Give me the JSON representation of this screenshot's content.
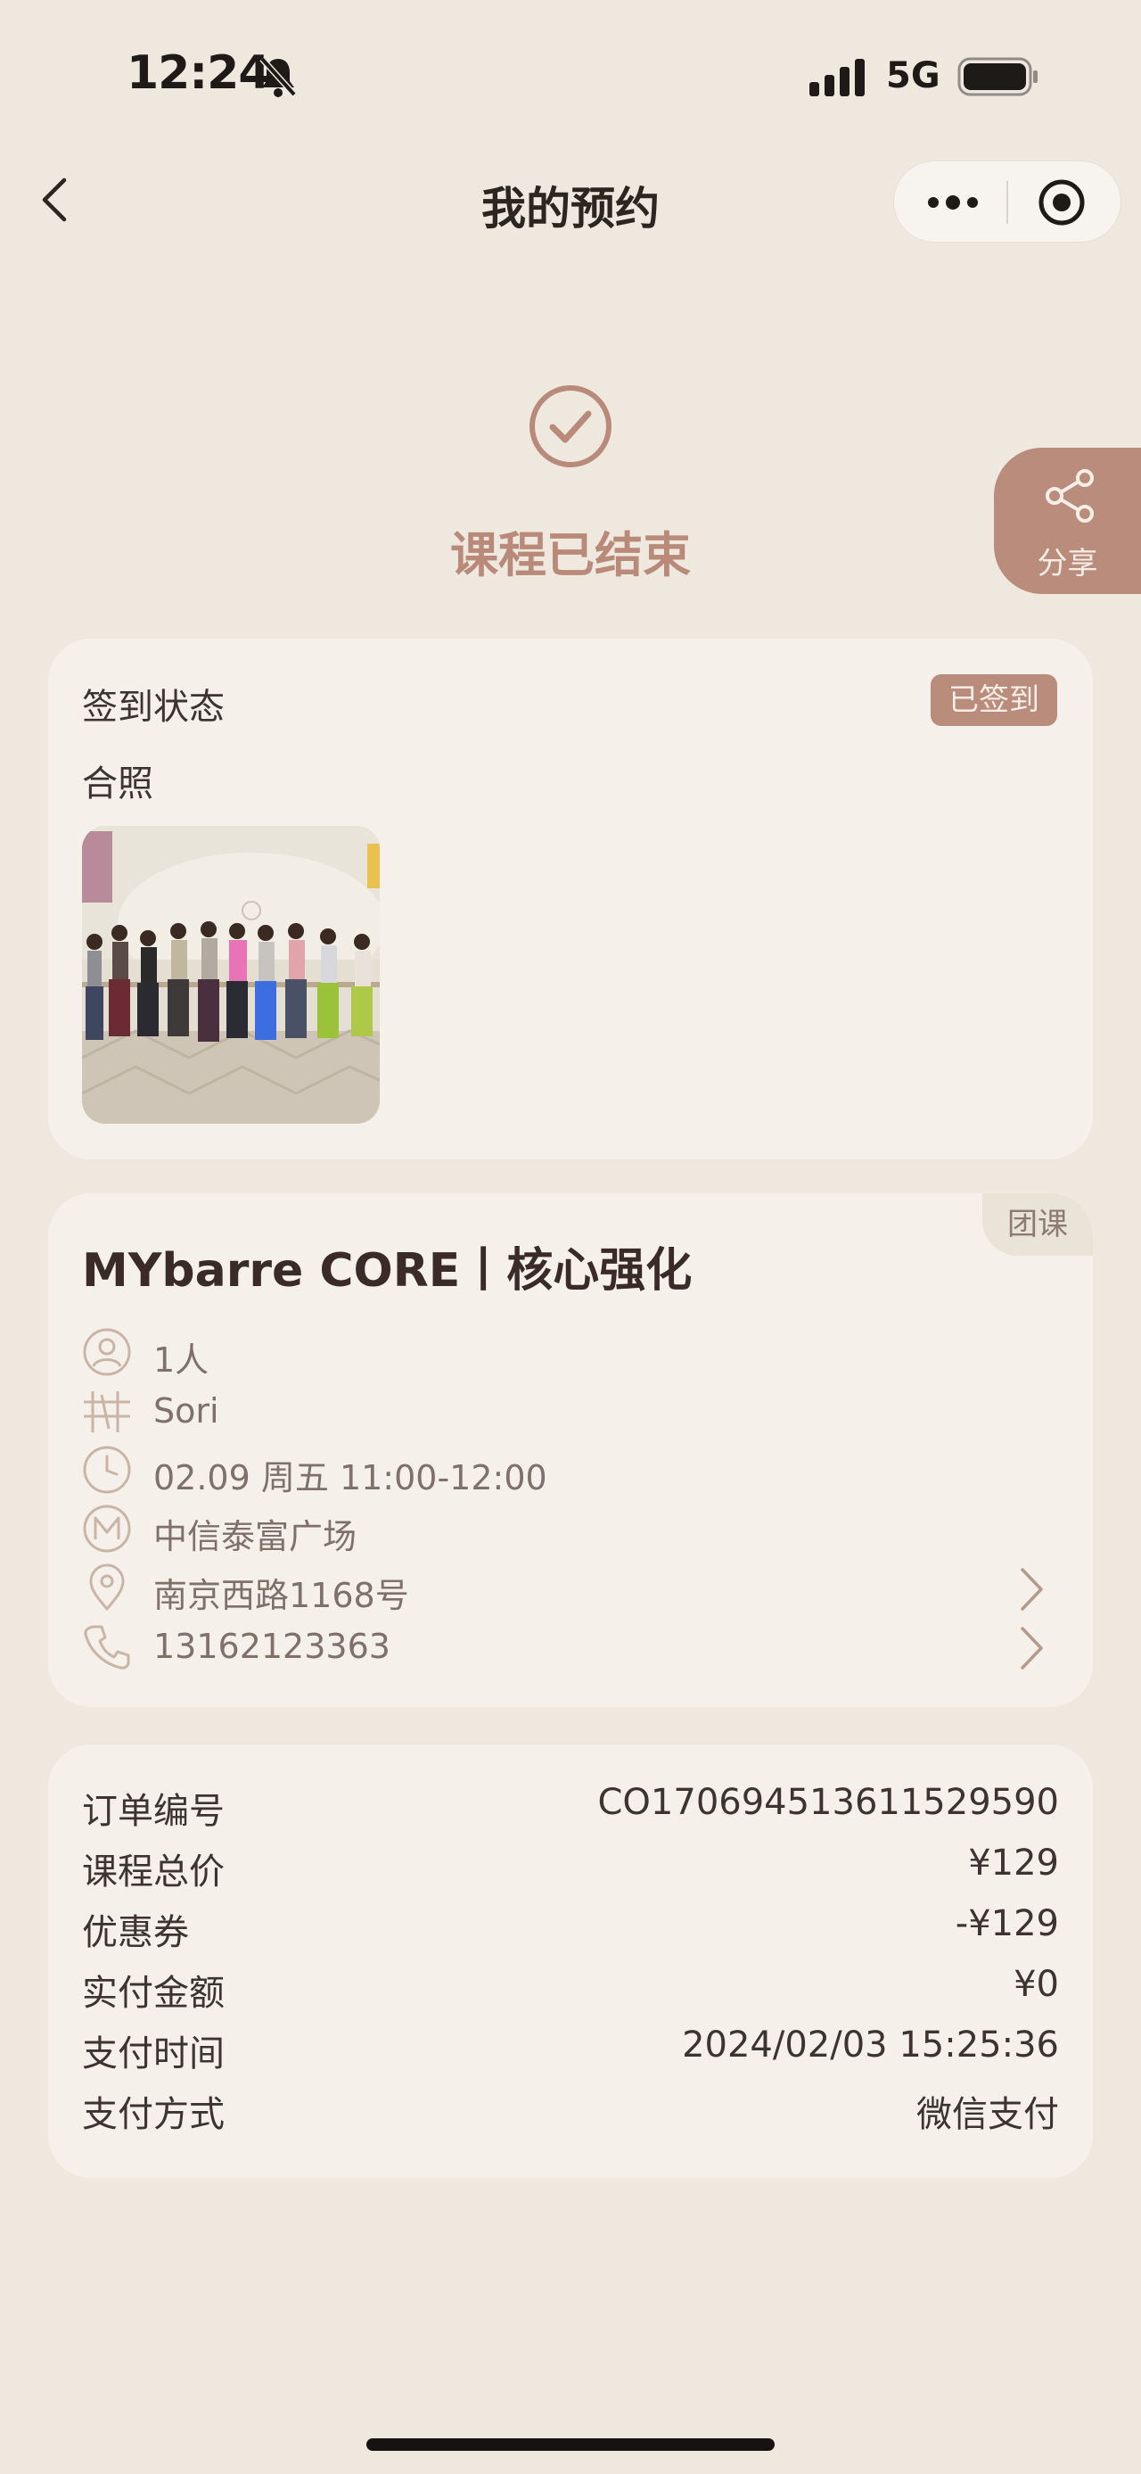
{
  "status_bar": {
    "time": "12:24",
    "network": "5G",
    "icons": [
      "bell-muted-icon",
      "signal-icon",
      "battery-icon"
    ]
  },
  "nav": {
    "title": "我的预约",
    "icons": [
      "back-icon",
      "more-icon",
      "target-icon"
    ]
  },
  "header": {
    "status_title": "课程已结束",
    "icon": "check-circle-icon",
    "accent": "#B98A79"
  },
  "share": {
    "label": "分享",
    "icon": "share-icon"
  },
  "checkin_card": {
    "status_label": "签到状态",
    "badge": "已签到",
    "photo_label": "合照"
  },
  "course": {
    "tag": "团课",
    "title": "MYbarre CORE丨核心强化",
    "rows": [
      {
        "icon": "person-icon",
        "text": "1人"
      },
      {
        "icon": "barre-icon",
        "text": "Sori"
      },
      {
        "icon": "clock-icon",
        "text": "02.09 周五 11:00-12:00"
      },
      {
        "icon": "brand-m-icon",
        "text": "中信泰富广场"
      },
      {
        "icon": "location-icon",
        "text": "南京西路1168号"
      },
      {
        "icon": "phone-icon",
        "text": "13162123363"
      }
    ]
  },
  "order": {
    "rows": [
      {
        "label": "订单编号",
        "value": "CO170694513611529590"
      },
      {
        "label": "课程总价",
        "value": "¥129"
      },
      {
        "label": "优惠券",
        "value": "-¥129"
      },
      {
        "label": "实付金额",
        "value": "¥0"
      },
      {
        "label": "支付时间",
        "value": "2024/02/03 15:25:36"
      },
      {
        "label": "支付方式",
        "value": "微信支付"
      }
    ]
  },
  "colors": {
    "background": "#EEE8DF",
    "card": "#F5F0EA",
    "accent": "#B98C7C"
  }
}
